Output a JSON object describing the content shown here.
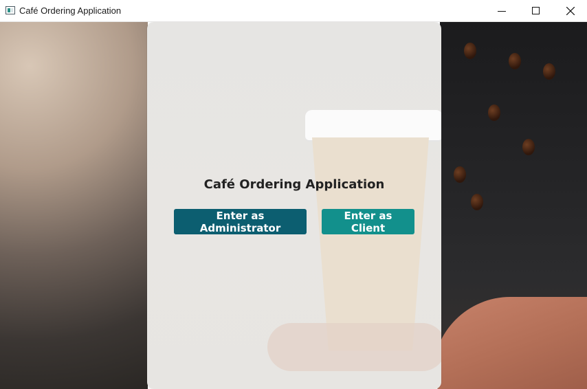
{
  "window": {
    "title": "Café Ordering Application",
    "controls": {
      "minimize": "minimize",
      "maximize": "maximize",
      "close": "close"
    }
  },
  "main": {
    "heading": "Café Ordering Application",
    "buttons": {
      "admin_label": "Enter as Administrator",
      "client_label": "Enter as Client"
    }
  },
  "colors": {
    "admin_button": "#0c5e70",
    "client_button": "#12908c",
    "panel": "#e6e5e3",
    "heading_text": "#222222"
  },
  "icons": [
    "app-window-icon",
    "minimize-icon",
    "maximize-icon",
    "close-icon"
  ]
}
